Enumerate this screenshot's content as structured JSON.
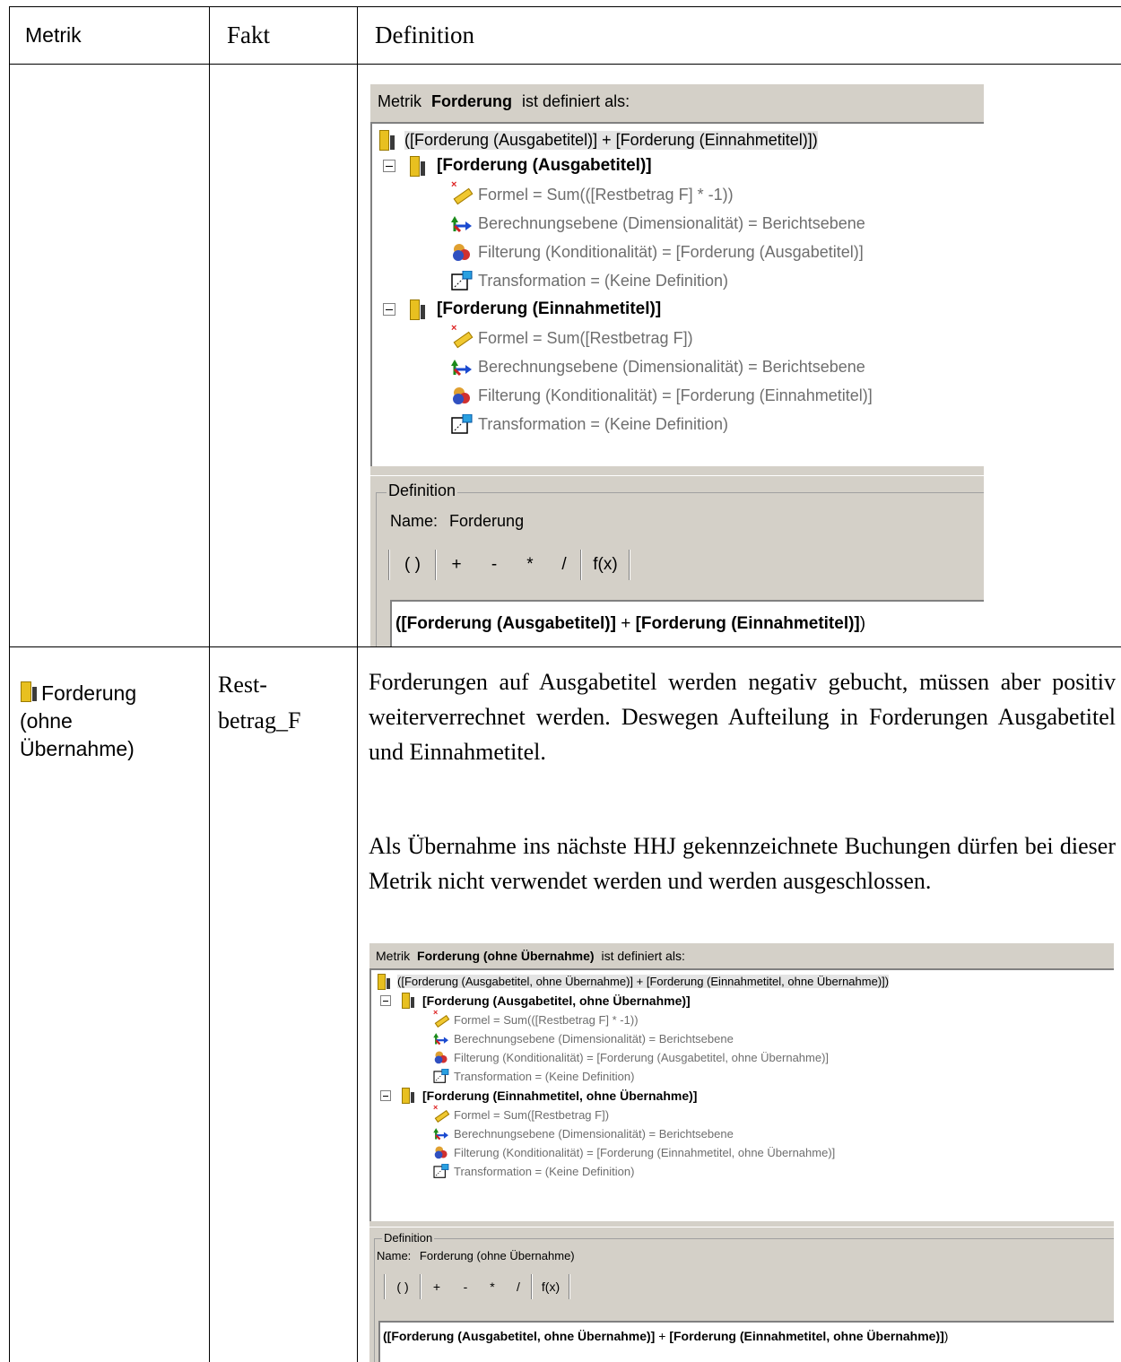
{
  "table": {
    "headers": {
      "metrik": "Metrik",
      "fakt": "Fakt",
      "definition": "Definition"
    },
    "row2": {
      "metric_lines": [
        "Forderung",
        "(ohne",
        "Übernahme)"
      ],
      "fact_lines": [
        "Rest-",
        "betrag_F"
      ],
      "paragraph1": "Forderungen auf Ausgabetitel werden negativ gebucht, müssen aber positiv weiterverrechnet werden. Deswegen Aufteilung in Forderungen Ausgabetitel und Einnahmetitel.",
      "paragraph2": "Als Übernahme ins nächste HHJ gekennzeichnete Buchungen dürfen bei dieser Metrik nicht verwendet werden und werden ausgeschlossen."
    }
  },
  "screenshot1": {
    "header_prefix": "Metrik",
    "header_name": "Forderung",
    "header_suffix": "ist definiert als:",
    "root": "([Forderung (Ausgabetitel)] + [Forderung (Einnahmetitel)])",
    "groups": [
      {
        "title": "[Forderung (Ausgabetitel)]",
        "formel": "Formel = Sum(([Restbetrag F] * -1))",
        "berechnung": "Berechnungsebene (Dimensionalität) = Berichtsebene",
        "filter": "Filterung (Konditionalität) = [Forderung (Ausgabetitel)]",
        "transformation": "Transformation = (Keine Definition)"
      },
      {
        "title": "[Forderung (Einnahmetitel)]",
        "formel": "Formel = Sum([Restbetrag F])",
        "berechnung": "Berechnungsebene (Dimensionalität) = Berichtsebene",
        "filter": "Filterung (Konditionalität) = [Forderung (Einnahmetitel)]",
        "transformation": "Transformation = (Keine Definition)"
      }
    ],
    "definition_legend": "Definition",
    "name_label": "Name:",
    "name_value": "Forderung",
    "toolbar": [
      "( )",
      "+",
      "-",
      "*",
      "/",
      "f(x)"
    ],
    "formula_bold1": "([Forderung (Ausgabetitel)]",
    "formula_plus": " + ",
    "formula_bold2": "[Forderung (Einnahmetitel)]",
    "formula_end": ")"
  },
  "screenshot2": {
    "header_prefix": "Metrik",
    "header_name": "Forderung (ohne Übernahme)",
    "header_suffix": "ist definiert als:",
    "root": "([Forderung (Ausgabetitel, ohne Übernahme)] + [Forderung (Einnahmetitel, ohne Übernahme)])",
    "groups": [
      {
        "title": "[Forderung (Ausgabetitel, ohne Übernahme)]",
        "formel": "Formel = Sum(([Restbetrag F] * -1))",
        "berechnung": "Berechnungsebene (Dimensionalität) = Berichtsebene",
        "filter": "Filterung (Konditionalität) = [Forderung (Ausgabetitel, ohne Übernahme)]",
        "transformation": "Transformation = (Keine Definition)"
      },
      {
        "title": "[Forderung (Einnahmetitel, ohne Übernahme)]",
        "formel": "Formel = Sum([Restbetrag F])",
        "berechnung": "Berechnungsebene (Dimensionalität) = Berichtsebene",
        "filter": "Filterung (Konditionalität) = [Forderung (Einnahmetitel, ohne Übernahme)]",
        "transformation": "Transformation = (Keine Definition)"
      }
    ],
    "definition_legend": "Definition",
    "name_label": "Name:",
    "name_value": "Forderung (ohne Übernahme)",
    "toolbar": [
      "( )",
      "+",
      "-",
      "*",
      "/",
      "f(x)"
    ],
    "formula_bold1": "([Forderung (Ausgabetitel, ohne Übernahme)]",
    "formula_plus": " + ",
    "formula_bold2": "[Forderung (Einnahmetitel, ohne Übernahme)]",
    "formula_end": ")"
  }
}
